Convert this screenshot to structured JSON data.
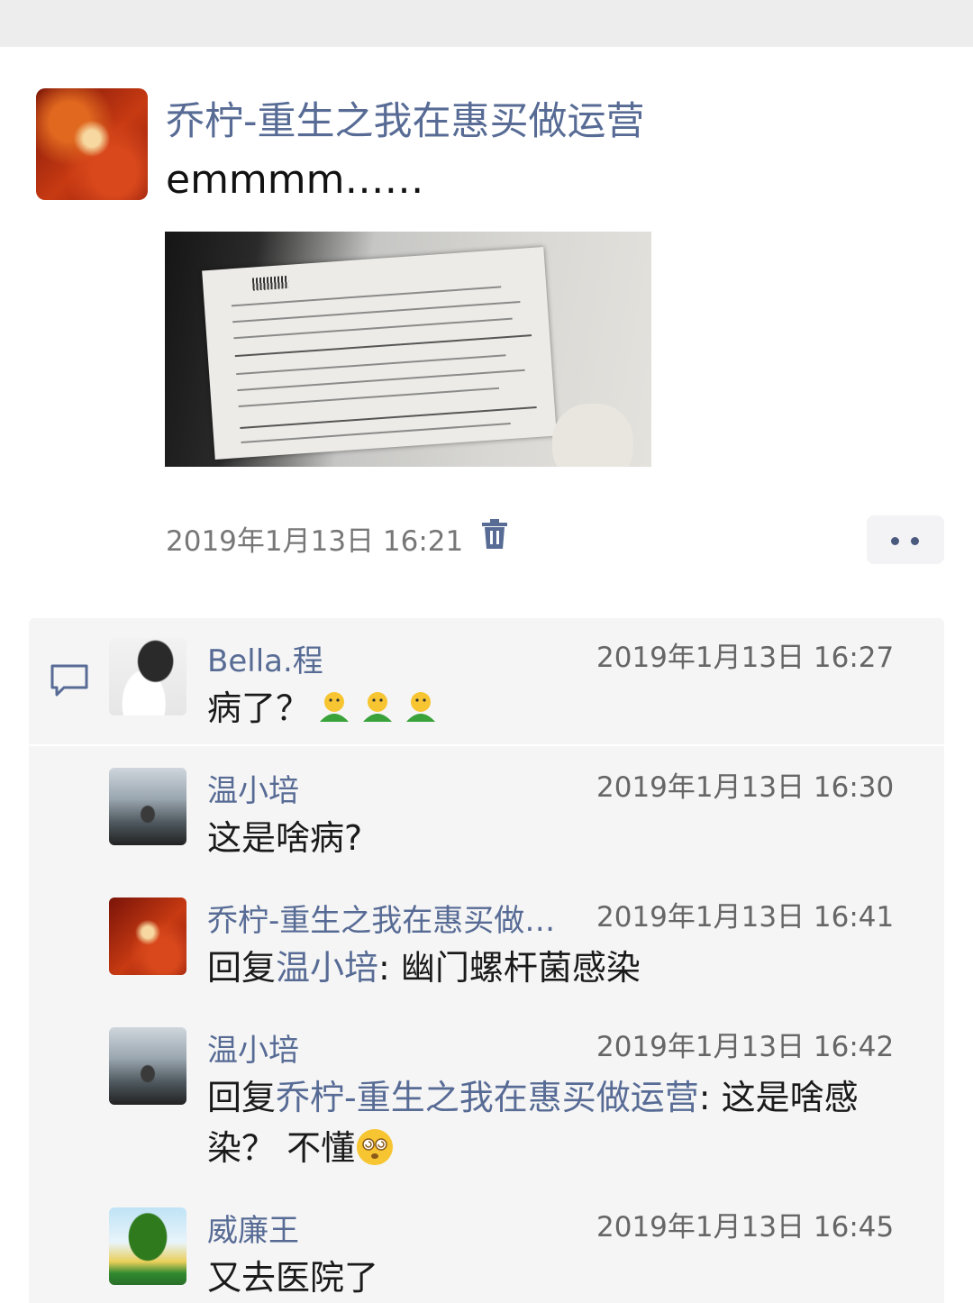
{
  "post": {
    "author": "乔柠-重生之我在惠买做运营",
    "text": "emmmm……",
    "time": "2019年1月13日 16:21"
  },
  "icons": {
    "trash": "trash-icon",
    "more": "more-dots-icon",
    "comment": "comment-bubble-icon"
  },
  "colors": {
    "name": "#576b95",
    "comment_bg": "#f5f5f5"
  },
  "comments": [
    {
      "name": "Bella.程",
      "time": "2019年1月13日 16:27",
      "text": "病了？"
    },
    {
      "name": "温小培",
      "time": "2019年1月13日 16:30",
      "text": "这是啥病?"
    },
    {
      "name": "乔柠-重生之我在惠买做…",
      "time": "2019年1月13日 16:41",
      "reply_prefix": "回复",
      "reply_to": "温小培",
      "reply_sep": ": ",
      "text": "幽门螺杆菌感染"
    },
    {
      "name": "温小培",
      "time": "2019年1月13日 16:42",
      "reply_prefix": "回复",
      "reply_to": "乔柠-重生之我在惠买做运营",
      "reply_sep": ": ",
      "text": "这是啥感染？ 不懂"
    },
    {
      "name": "威廉王",
      "time": "2019年1月13日 16:45",
      "text": "又去医院了"
    }
  ]
}
